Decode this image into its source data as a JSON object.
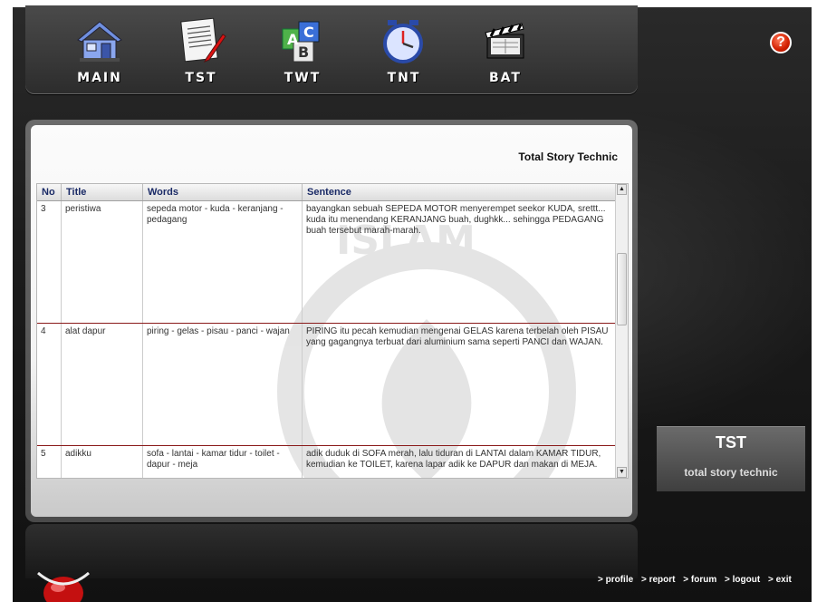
{
  "nav": {
    "items": [
      {
        "label": "MAIN",
        "icon": "house-icon"
      },
      {
        "label": "TST",
        "icon": "document-pen-icon"
      },
      {
        "label": "TWT",
        "icon": "abc-blocks-icon"
      },
      {
        "label": "TNT",
        "icon": "clock-icon"
      },
      {
        "label": "BAT",
        "icon": "clapperboard-icon"
      }
    ],
    "help_label": "?"
  },
  "panel": {
    "title": "Total Story Technic",
    "table": {
      "headers": [
        "No",
        "Title",
        "Words",
        "Sentence"
      ],
      "rows": [
        {
          "no": "3",
          "title": "peristiwa",
          "words": "sepeda motor - kuda - keranjang - pedagang",
          "sentence": "bayangkan sebuah SEPEDA MOTOR menyerempet seekor KUDA, srettt... kuda itu menendang KERANJANG buah, dughkk... sehingga PEDAGANG buah tersebut marah-marah."
        },
        {
          "no": "4",
          "title": "alat dapur",
          "words": "piring - gelas - pisau - panci - wajan",
          "sentence": "PIRING itu pecah kemudian mengenai GELAS karena terbelah oleh PISAU yang gagangnya terbuat dari aluminium sama seperti PANCI dan WAJAN."
        },
        {
          "no": "5",
          "title": "adikku",
          "words": "sofa - lantai - kamar tidur - toilet - dapur - meja",
          "sentence": "adik duduk di SOFA merah, lalu tiduran di LANTAI dalam KAMAR TIDUR, kemudian ke TOILET, karena lapar adik ke DAPUR dan makan di MEJA."
        }
      ]
    }
  },
  "side_box": {
    "big": "TST",
    "small": "total story technic"
  },
  "footer": {
    "links": [
      "> profile",
      "> report",
      "> forum",
      "> logout",
      "> exit"
    ]
  },
  "watermark_text": "ISLAM",
  "colors": {
    "accent_red": "#8a1a1a",
    "header_text": "#1a2a66"
  }
}
